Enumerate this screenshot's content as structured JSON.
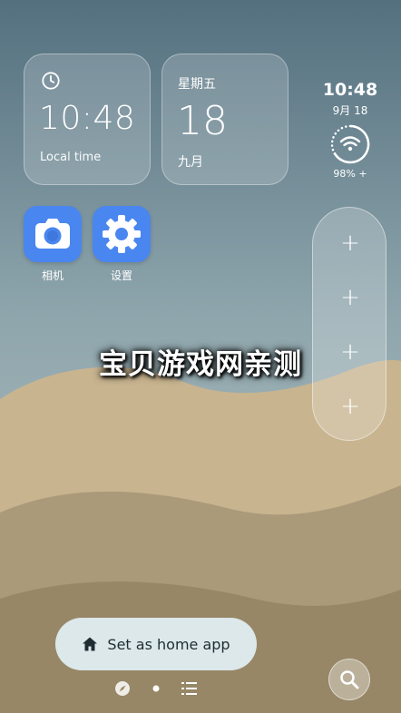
{
  "clock_widget": {
    "time": "10:48",
    "label": "Local time",
    "icon": "clock-icon"
  },
  "date_widget": {
    "weekday": "星期五",
    "day": "18",
    "month": "九月"
  },
  "status": {
    "time": "10:48",
    "date": "9月 18",
    "battery": "98% +",
    "icon": "wifi-icon"
  },
  "apps": [
    {
      "label": "相机",
      "icon": "camera-icon"
    },
    {
      "label": "设置",
      "icon": "gear-icon"
    }
  ],
  "dock": {
    "slots": [
      "+",
      "+",
      "+",
      "+"
    ]
  },
  "watermark": "宝贝游戏网亲测",
  "home_prompt": {
    "label": "Set as home app",
    "icon": "home-icon"
  },
  "search": {
    "icon": "search-icon"
  },
  "pager": {
    "icons": [
      "compass-icon",
      "page-dot-icon",
      "list-icon"
    ]
  },
  "colors": {
    "app_icon_bg": "#4a86f0",
    "pill_bg": "#dce8ea",
    "sky_top": "#54707f",
    "sand": "#c8b48f"
  }
}
